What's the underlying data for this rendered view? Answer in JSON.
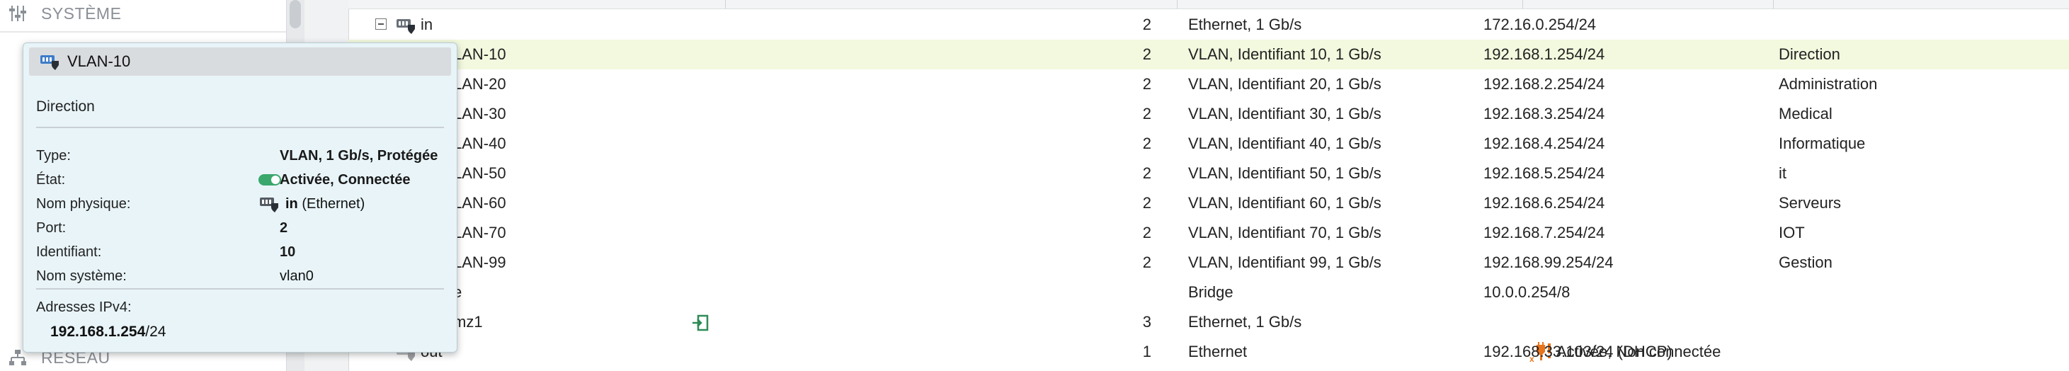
{
  "sidebar": {
    "systeme_label": "SYSTÈME",
    "reseau_label": "RÉSEAU"
  },
  "rows": [
    {
      "name": "in",
      "port": "2",
      "type": "Ethernet, 1 Gb/s",
      "status": "",
      "ipv4": "172.16.0.254/24",
      "comment": ""
    },
    {
      "name": "LAN-10",
      "port": "2",
      "type": "VLAN, Identifiant 10, 1 Gb/s",
      "status": "",
      "ipv4": "192.168.1.254/24",
      "comment": "Direction"
    },
    {
      "name": "LAN-20",
      "port": "2",
      "type": "VLAN, Identifiant 20, 1 Gb/s",
      "status": "",
      "ipv4": "192.168.2.254/24",
      "comment": "Administration"
    },
    {
      "name": "LAN-30",
      "port": "2",
      "type": "VLAN, Identifiant 30, 1 Gb/s",
      "status": "",
      "ipv4": "192.168.3.254/24",
      "comment": "Medical"
    },
    {
      "name": "LAN-40",
      "port": "2",
      "type": "VLAN, Identifiant 40, 1 Gb/s",
      "status": "",
      "ipv4": "192.168.4.254/24",
      "comment": "Informatique"
    },
    {
      "name": "LAN-50",
      "port": "2",
      "type": "VLAN, Identifiant 50, 1 Gb/s",
      "status": "",
      "ipv4": "192.168.5.254/24",
      "comment": "it"
    },
    {
      "name": "LAN-60",
      "port": "2",
      "type": "VLAN, Identifiant 60, 1 Gb/s",
      "status": "",
      "ipv4": "192.168.6.254/24",
      "comment": "Serveurs"
    },
    {
      "name": "LAN-70",
      "port": "2",
      "type": "VLAN, Identifiant 70, 1 Gb/s",
      "status": "",
      "ipv4": "192.168.7.254/24",
      "comment": "IOT"
    },
    {
      "name": "LAN-99",
      "port": "2",
      "type": "VLAN, Identifiant 99, 1 Gb/s",
      "status": "",
      "ipv4": "192.168.99.254/24",
      "comment": "Gestion"
    },
    {
      "name": "e",
      "port": "",
      "type": "Bridge",
      "status": "",
      "ipv4": "10.0.0.254/8",
      "comment": ""
    },
    {
      "name": "mz1",
      "port": "3",
      "type": "Ethernet, 1 Gb/s",
      "status": "",
      "ipv4": "",
      "comment": ""
    },
    {
      "name": "out",
      "port": "1",
      "type": "Ethernet",
      "status": "Activée, Non connectée",
      "ipv4": "192.168.33.103/24 (DHCP)",
      "comment": ""
    }
  ],
  "tooltip": {
    "title": "VLAN-10",
    "description": "Direction",
    "type_label": "Type:",
    "type_value": "VLAN, 1 Gb/s, Protégée",
    "state_label": "État:",
    "state_value": "Activée, Connectée",
    "physical_label": "Nom physique:",
    "physical_value": "in",
    "physical_suffix": " (Ethernet)",
    "port_label": "Port:",
    "port_value": "2",
    "id_label": "Identifiant:",
    "id_value": "10",
    "sysname_label": "Nom système:",
    "sysname_value": "vlan0",
    "ipv4_label": "Adresses IPv4:",
    "ipv4_main": "192.168.1.254",
    "ipv4_mask": "/24"
  },
  "colors": {
    "selected_row": "#f2f9de",
    "tooltip_bg": "#e8f4f8",
    "toggle_on": "#3aa76d",
    "warning": "#e8741b",
    "link_icon": "#2e8b57"
  }
}
